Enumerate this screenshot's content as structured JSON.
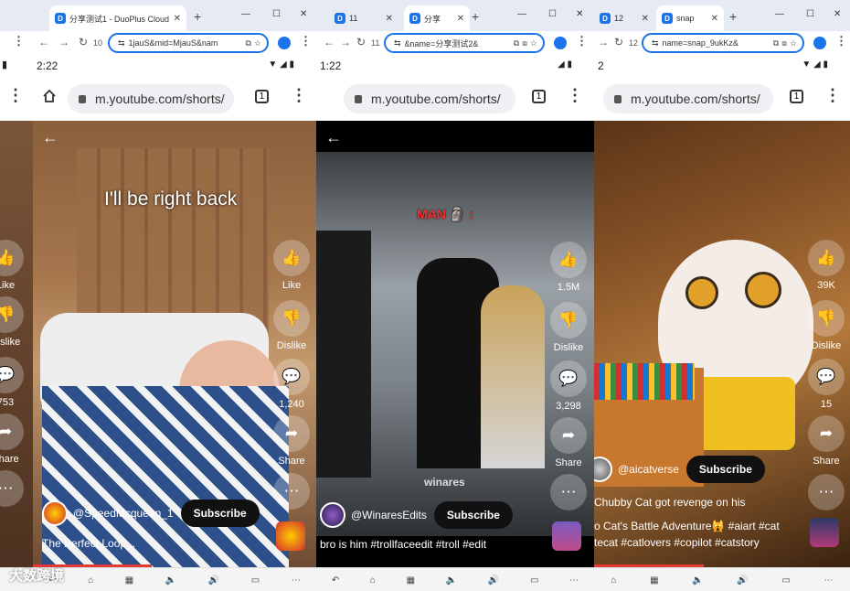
{
  "windows": [
    {
      "tab_label": "分享测试1 - DuoPlus Cloud P",
      "tab_number": "10",
      "url_fragment": "1jauS&mid=MjauS&nam",
      "time": "2:22",
      "address": "m.youtube.com/shorts/",
      "tab_count": "1",
      "overlay": "I'll be right back",
      "like_label": "Like",
      "dislike_label": "Dislike",
      "comments": "1,240",
      "share_label": "Share",
      "channel": "@SpeedMcqueen_1",
      "subscribe": "Subscribe",
      "caption": "The Perfect Loop..."
    },
    {
      "tab_label": "11",
      "tab_label_2": "分享",
      "tab_number": "11",
      "url_fragment": "&name=分享测试2&",
      "time": "1:22",
      "address": "m.youtube.com/shorts/",
      "tab_count": "1",
      "overlay": "MAN 🗿 :",
      "watermark": "winares",
      "likes": "1.5M",
      "dislike_label": "Dislike",
      "comments": "3,298",
      "share_label": "Share",
      "channel": "@WinaresEdits",
      "subscribe": "Subscribe",
      "caption": "bro is him #trollfaceedit #troll #edit"
    },
    {
      "tab_label": "12",
      "tab_label_2": "snap",
      "tab_number": "12",
      "url_fragment": "name=snap_9ukKz&",
      "time": "2",
      "address": "m.youtube.com/shorts/",
      "tab_count": "1",
      "likes": "39K",
      "dislike_label": "Dislike",
      "comments": "15",
      "share_label": "Share",
      "channel": "@aicatverse",
      "subscribe": "Subscribe",
      "title_line": "Chubby Cat got revenge on his",
      "caption_1": "o Cat's Battle Adventure🙀 #aiart #cat",
      "caption_2": "tecat #catlovers #copilot #catstory"
    }
  ],
  "left_strip": {
    "like_label": "Like",
    "dislike_label": "Dislike",
    "comments": "753",
    "share_label": "Share"
  },
  "watermark_logo": "大数跨境",
  "colors": {
    "accent": "#1a73e8",
    "subscribe_bg": "#111111",
    "progress": "#e53935"
  }
}
